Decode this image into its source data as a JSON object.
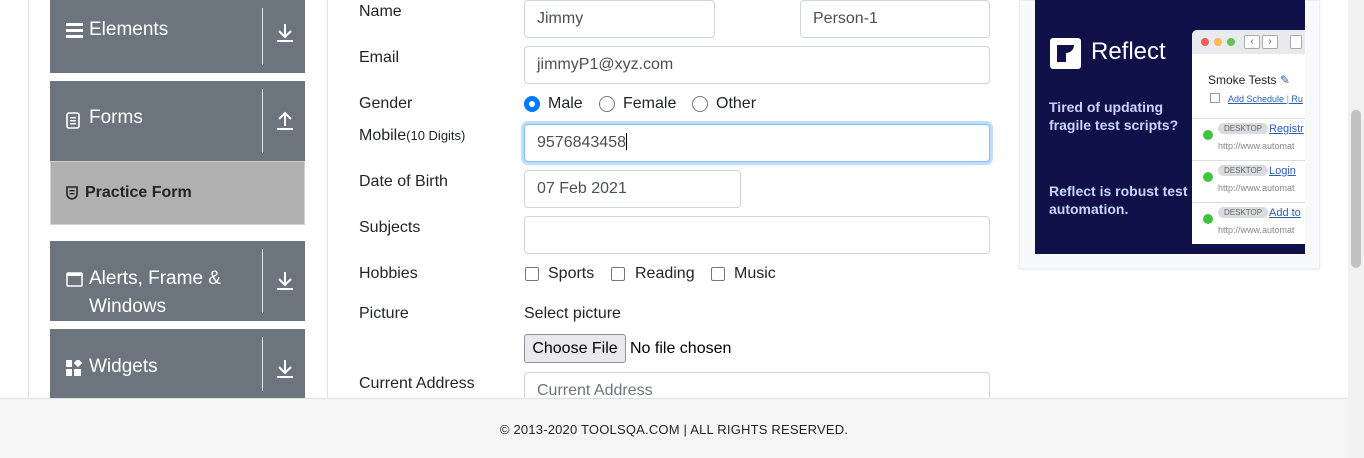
{
  "sidebar": {
    "groups": [
      {
        "label": "Elements",
        "icon": "hamburger-icon",
        "arrow": "download-arrow-icon"
      },
      {
        "label": "Forms",
        "icon": "document-icon",
        "arrow": "upload-arrow-icon"
      },
      {
        "label": "Alerts, Frame &",
        "label2": "Windows",
        "icon": "window-icon",
        "arrow": "download-arrow-icon"
      },
      {
        "label": "Widgets",
        "icon": "widgets-icon",
        "arrow": "download-arrow-icon"
      }
    ],
    "active_item": {
      "label": "Practice Form",
      "icon": "shield-icon"
    }
  },
  "form": {
    "name_label": "Name",
    "first_name": "Jimmy",
    "last_name": "Person-1",
    "email_label": "Email",
    "email": "jimmyP1@xyz.com",
    "gender_label": "Gender",
    "gender_options": [
      "Male",
      "Female",
      "Other"
    ],
    "gender_selected": "Male",
    "mobile_label": "Mobile",
    "mobile_hint": "(10 Digits)",
    "mobile": "9576843458",
    "dob_label": "Date of Birth",
    "dob": "07 Feb 2021",
    "subjects_label": "Subjects",
    "subjects_value": "",
    "hobbies_label": "Hobbies",
    "hobbies": [
      {
        "label": "Sports",
        "checked": false
      },
      {
        "label": "Reading",
        "checked": false
      },
      {
        "label": "Music",
        "checked": false
      }
    ],
    "picture_label": "Picture",
    "select_picture": "Select picture",
    "choose_file": "Choose File",
    "no_file": "No file chosen",
    "address_label": "Current Address",
    "address_placeholder": "Current Address"
  },
  "ad": {
    "brand": "Reflect",
    "tagline1": "Tired of updating fragile test scripts?",
    "tagline2": "Reflect is robust test automation.",
    "mock_title": "Smoke Tests",
    "mock_schedule": "Add Schedule",
    "mock_schedule_extra": "Ru",
    "mock_rows": [
      {
        "badge": "DESKTOP",
        "test": "Registr",
        "url": "http://www.automat"
      },
      {
        "badge": "DESKTOP",
        "test": "Login",
        "url": "http://www.automat"
      },
      {
        "badge": "DESKTOP",
        "test": "Add to",
        "url": "http://www.automat"
      }
    ]
  },
  "footer": {
    "copyright": "© 2013-2020 TOOLSQA.COM | ALL RIGHTS RESERVED."
  },
  "colors": {
    "sidebar_group": "#6c757d",
    "sidebar_active": "#b0b0b0",
    "radio_checked": "#007bff",
    "ad_background": "#0f1148"
  }
}
